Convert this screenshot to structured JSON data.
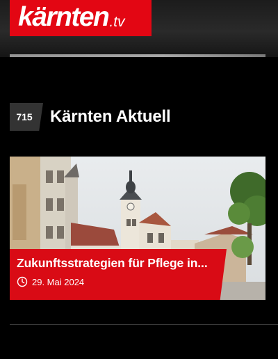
{
  "header": {
    "logo": {
      "main": "kärnten",
      "tld": ".tv"
    }
  },
  "channel": {
    "number": "715",
    "title": "Kärnten Aktuell"
  },
  "video": {
    "title": "Zukunftsstrategien für Pflege in...",
    "date": "29. Mai 2024",
    "date_icon": "clock-icon"
  },
  "colors": {
    "brand_red": "#e30613",
    "caption_red": "#d90b15",
    "background": "#000000",
    "channel_badge": "#333333"
  }
}
